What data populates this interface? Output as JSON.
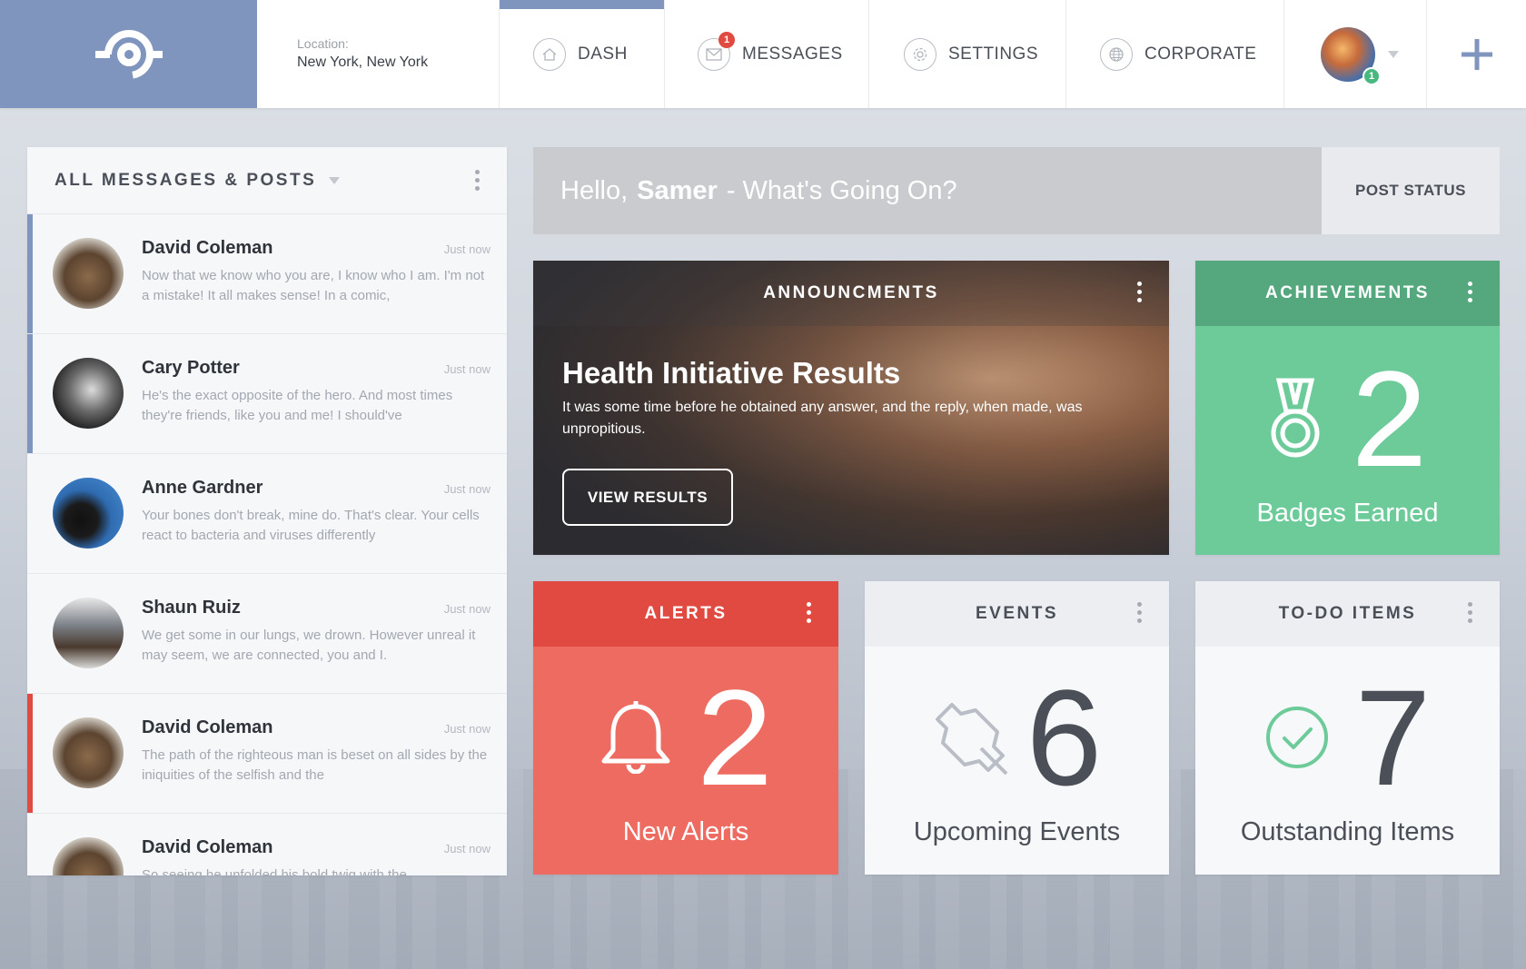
{
  "app": {
    "location_label": "Location:",
    "location_value": "New York, New York"
  },
  "nav": {
    "items": [
      {
        "label": "DASH",
        "icon": "home-icon",
        "active": true
      },
      {
        "label": "MESSAGES",
        "icon": "envelope-icon",
        "badge": "1"
      },
      {
        "label": "SETTINGS",
        "icon": "gear-icon"
      },
      {
        "label": "CORPORATE",
        "icon": "globe-icon"
      }
    ],
    "profile_badge": "1",
    "add_icon": "plus-icon"
  },
  "messages_panel": {
    "title": "ALL MESSAGES & POSTS",
    "items": [
      {
        "name": "David Coleman",
        "time": "Just now",
        "text": "Now that we know who you are, I know who I am. I'm not a mistake! It all makes sense! In a comic,",
        "marker": "blue"
      },
      {
        "name": "Cary Potter",
        "time": "Just now",
        "text": "He's the exact opposite of the hero. And most times they're friends, like you and me! I should've",
        "marker": "blue"
      },
      {
        "name": "Anne Gardner",
        "time": "Just now",
        "text": "Your bones don't break, mine do. That's clear. Your cells react to bacteria and viruses differently",
        "marker": "none"
      },
      {
        "name": "Shaun Ruiz",
        "time": "Just now",
        "text": "We get some in our lungs, we drown. However unreal it may seem, we are connected, you and I.",
        "marker": "none"
      },
      {
        "name": "David Coleman",
        "time": "Just now",
        "text": "The path of the righteous man is beset on all sides by the iniquities of the selfish and the",
        "marker": "red"
      },
      {
        "name": "David Coleman",
        "time": "Just now",
        "text": "So seeing he unfolded his bold twig with the",
        "marker": "none"
      }
    ]
  },
  "post": {
    "greeting_prefix": "Hello,",
    "user_name": "Samer",
    "greeting_suffix": "- What's Going On?",
    "button_label": "POST STATUS"
  },
  "announcements": {
    "title": "ANNOUNCMENTS",
    "headline": "Health Initiative Results",
    "description": "It was some time before he obtained any answer, and the reply, when made, was unpropitious.",
    "button_label": "VIEW RESULTS"
  },
  "achievements": {
    "title": "ACHIEVEMENTS",
    "count": "2",
    "label": "Badges Earned",
    "icon": "medal-icon"
  },
  "alerts": {
    "title": "ALERTS",
    "count": "2",
    "label": "New Alerts",
    "icon": "bell-icon"
  },
  "events": {
    "title": "EVENTS",
    "count": "6",
    "label": "Upcoming Events",
    "icon": "pushpin-icon"
  },
  "todo": {
    "title": "TO-DO ITEMS",
    "count": "7",
    "label": "Outstanding Items",
    "icon": "check-circle-icon"
  },
  "colors": {
    "brand": "#7f95be",
    "alert_red": "#e04a40",
    "success_green": "#6ccb99"
  }
}
